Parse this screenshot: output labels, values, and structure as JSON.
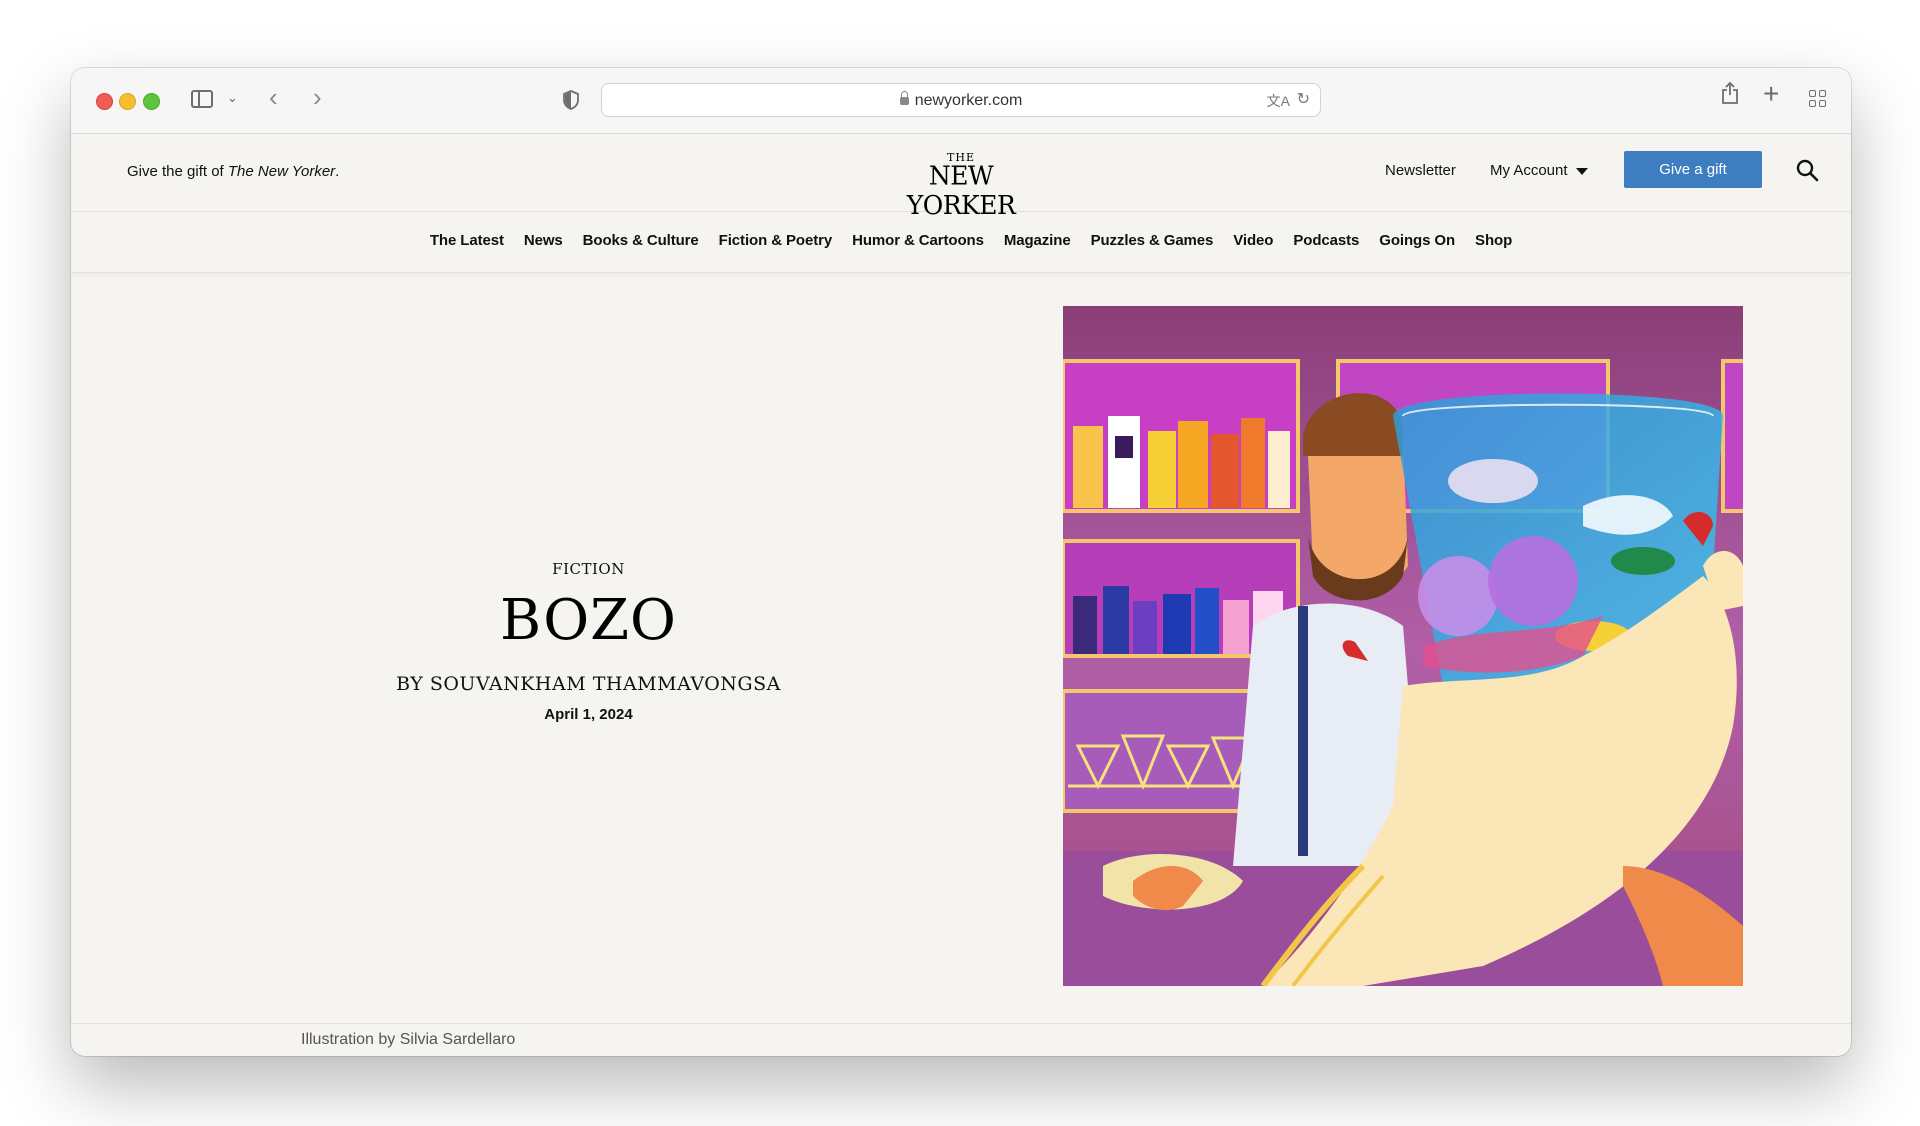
{
  "browser": {
    "url": "newyorker.com"
  },
  "header": {
    "gift_promo_prefix": "Give the gift of ",
    "gift_promo_title": "The New Yorker",
    "gift_promo_suffix": ".",
    "logo_the": "THE",
    "logo_name": "NEW YORKER",
    "newsletter": "Newsletter",
    "my_account": "My Account",
    "give_gift": "Give a gift"
  },
  "nav": {
    "items": [
      "The Latest",
      "News",
      "Books & Culture",
      "Fiction & Poetry",
      "Humor & Cartoons",
      "Magazine",
      "Puzzles & Games",
      "Video",
      "Podcasts",
      "Goings On",
      "Shop"
    ]
  },
  "article": {
    "rubric": "FICTION",
    "headline": "BOZO",
    "byline": "BY SOUVANKHAM THAMMAVONGSA",
    "date": "April 1, 2024",
    "illustration_credit": "Illustration by Silvia Sardellaro"
  },
  "colors": {
    "accent_button": "#3e7ec0",
    "page_bg": "#f5f4f1"
  }
}
